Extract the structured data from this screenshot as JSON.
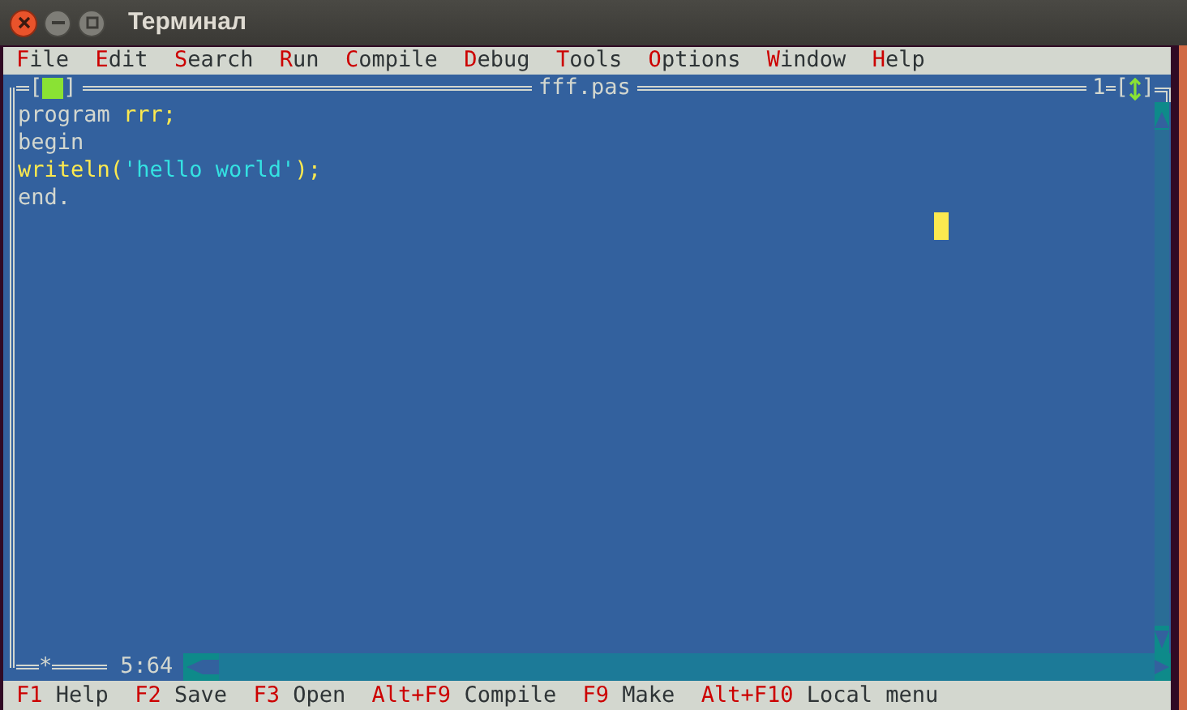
{
  "window": {
    "title": "Терминал"
  },
  "menu": [
    {
      "label": "File"
    },
    {
      "label": "Edit"
    },
    {
      "label": "Search"
    },
    {
      "label": "Run"
    },
    {
      "label": "Compile"
    },
    {
      "label": "Debug"
    },
    {
      "label": "Tools"
    },
    {
      "label": "Options"
    },
    {
      "label": "Window"
    },
    {
      "label": "Help"
    }
  ],
  "editor": {
    "close_box": [
      "[",
      "]"
    ],
    "title": "fff.pas",
    "zoom_box": [
      "[",
      "]"
    ],
    "window_number": "1",
    "modified_mark": "*",
    "cursor_position": "5:64",
    "lines": [
      [
        {
          "kind": "keyword",
          "text": "program"
        },
        {
          "kind": "symbol",
          "text": " rrr;"
        }
      ],
      [
        {
          "kind": "keyword",
          "text": "begin"
        }
      ],
      [
        {
          "kind": "symbol",
          "text": "writeln("
        },
        {
          "kind": "string",
          "text": "'hello world'"
        },
        {
          "kind": "symbol",
          "text": ");"
        }
      ],
      [
        {
          "kind": "keyword",
          "text": "end."
        }
      ]
    ]
  },
  "status_bar": [
    {
      "key": "F1",
      "label": "Help"
    },
    {
      "key": "F2",
      "label": "Save"
    },
    {
      "key": "F3",
      "label": "Open"
    },
    {
      "key": "Alt+F9",
      "label": "Compile"
    },
    {
      "key": "F9",
      "label": "Make"
    },
    {
      "key": "Alt+F10",
      "label": "Local menu"
    }
  ]
}
